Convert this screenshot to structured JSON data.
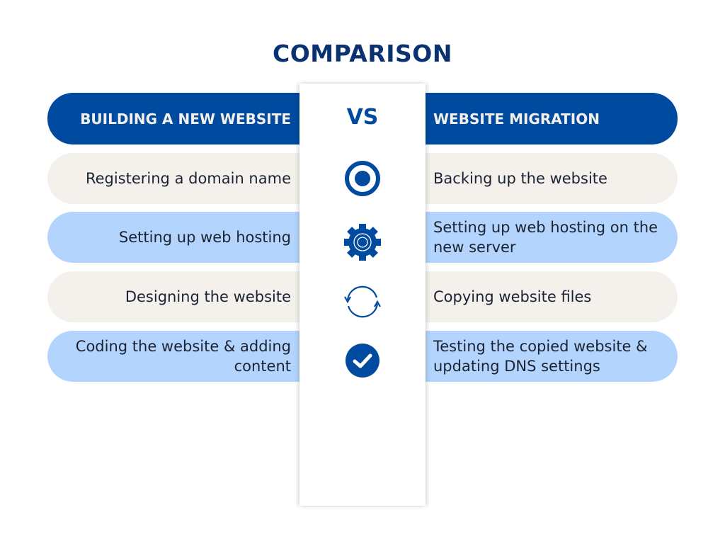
{
  "title": "COMPARISON",
  "vs_label": "VS",
  "left_column": {
    "header": "BUILDING A NEW WEBSITE",
    "items": [
      "Registering a domain name",
      "Setting up web hosting",
      "Designing the website",
      "Coding the website & adding content"
    ]
  },
  "right_column": {
    "header": "WEBSITE MIGRATION",
    "items": [
      "Backing up the website",
      "Setting up web hosting on the new server",
      "Copying website files",
      "Testing the copied website & updating DNS settings"
    ]
  },
  "icons": [
    "target-icon",
    "gear-icon",
    "sync-icon",
    "check-circle-icon"
  ],
  "colors": {
    "primary": "#004ba0",
    "title": "#0b3270",
    "row_beige": "#f4f1ec",
    "row_blue": "#b3d4fc",
    "text": "#1b2333"
  }
}
